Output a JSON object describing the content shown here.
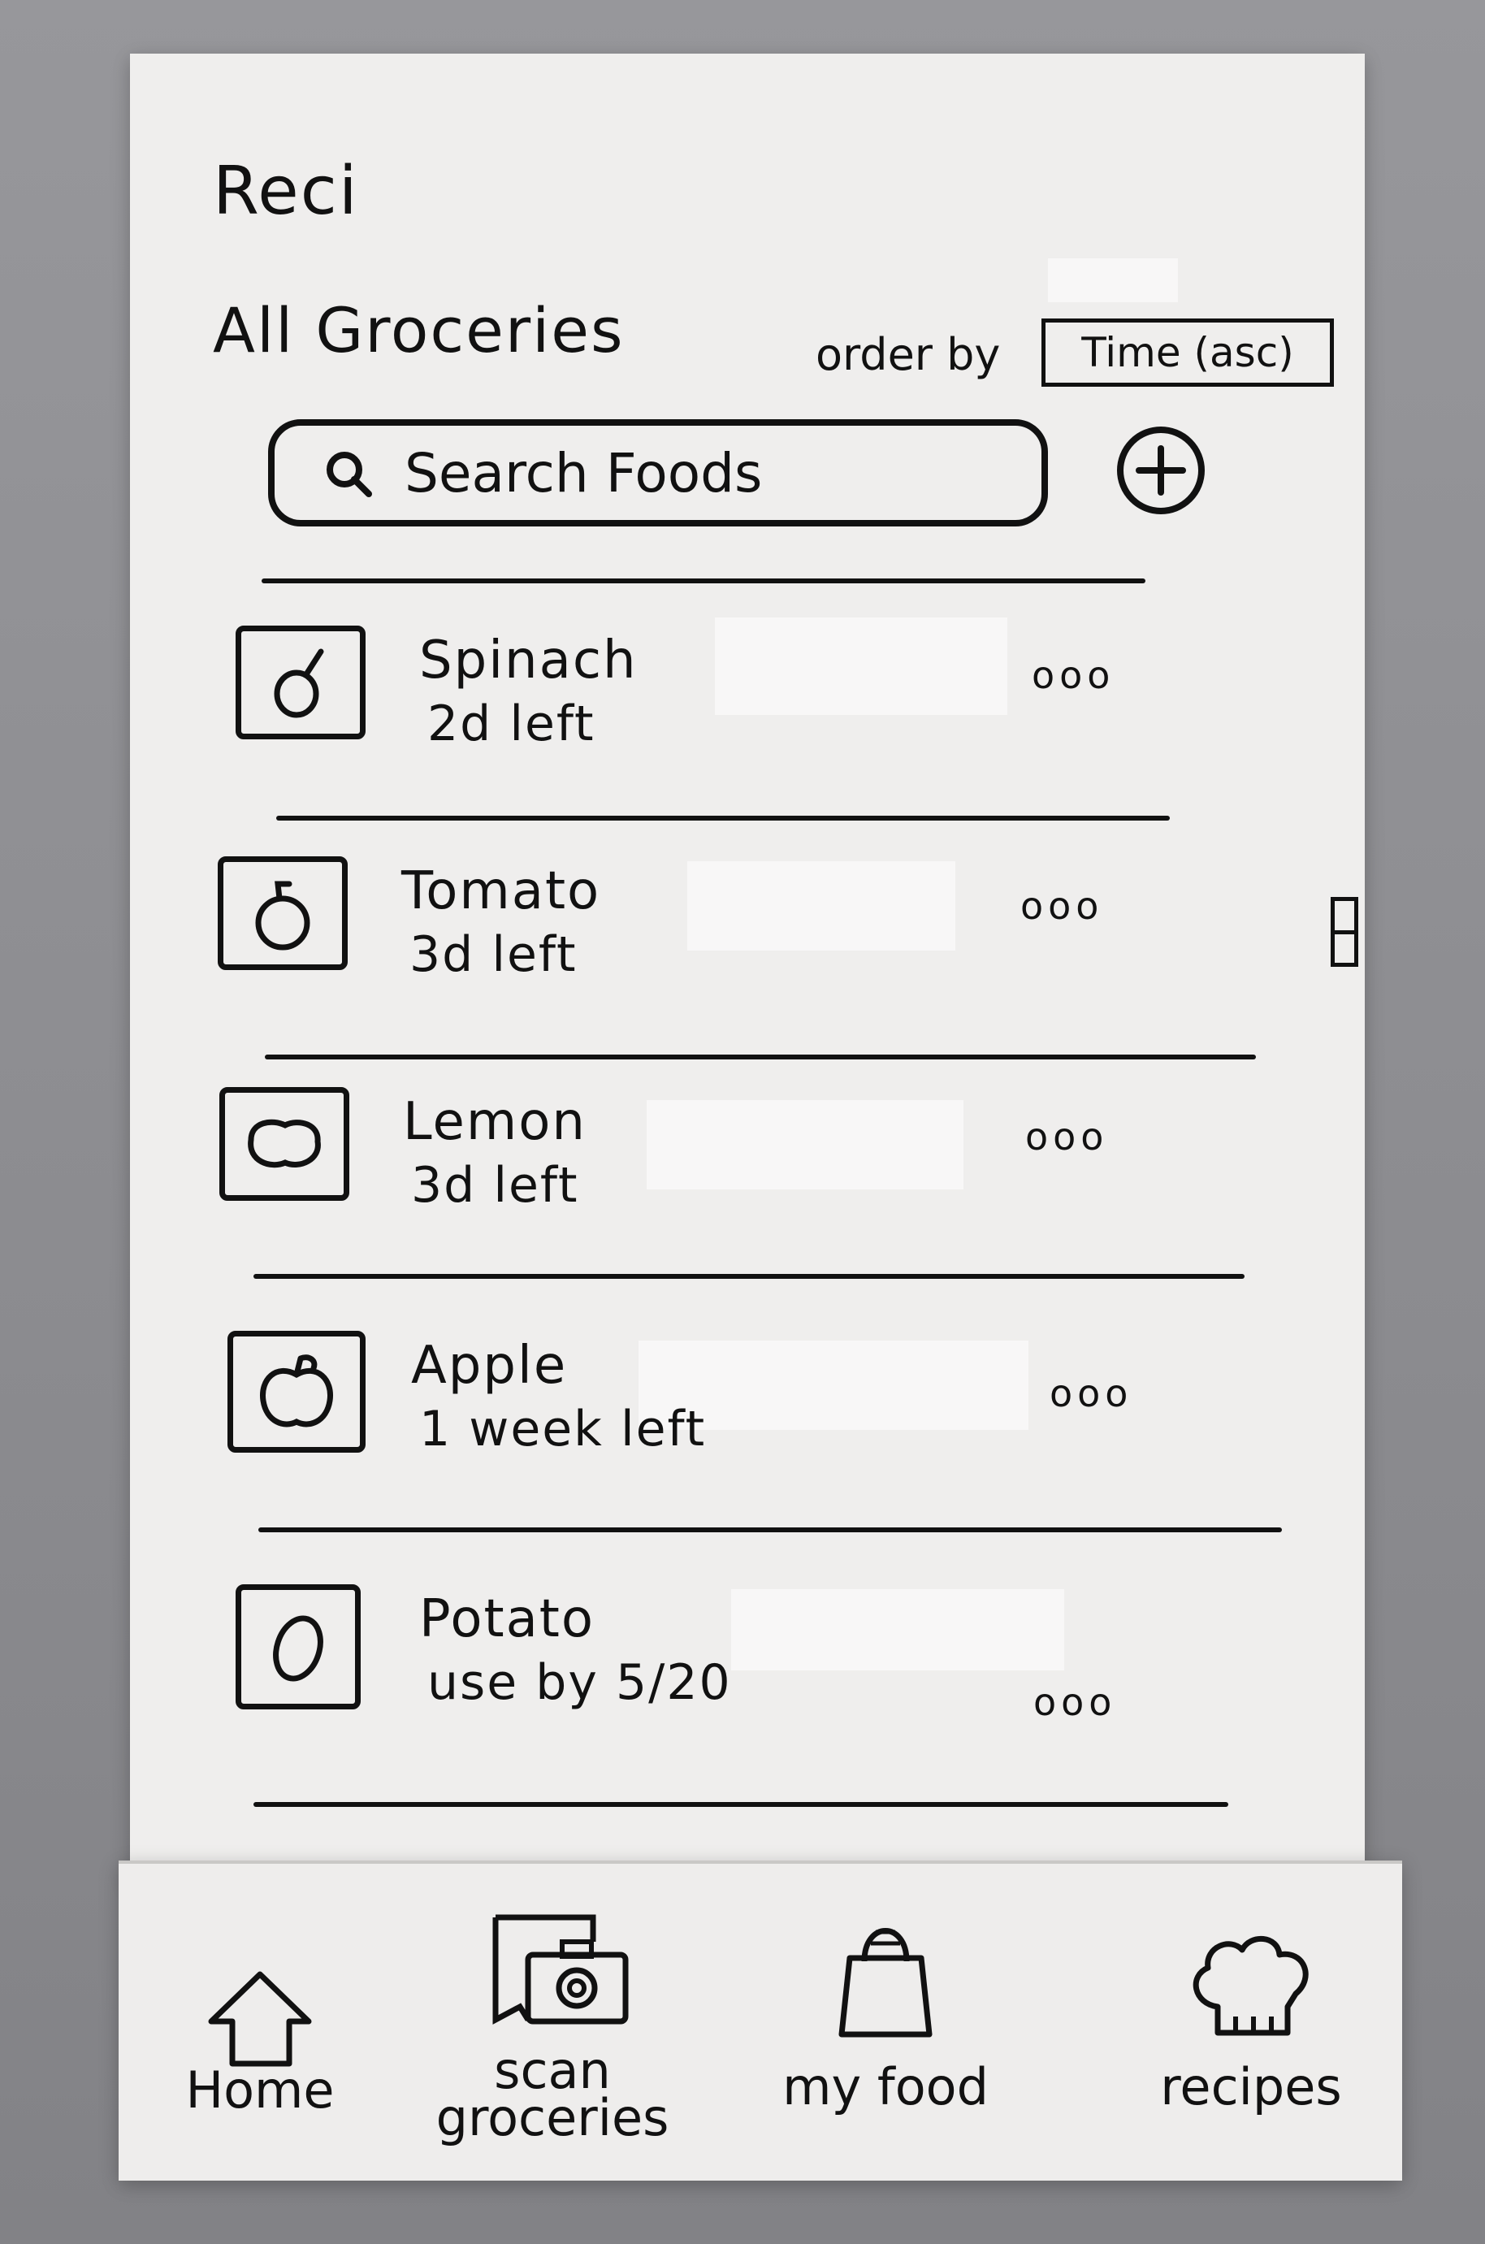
{
  "app": {
    "title": "Reci"
  },
  "header": {
    "section_title": "All Groceries",
    "order_label": "order by",
    "order_value": "Time (asc)"
  },
  "search": {
    "placeholder": "Search Foods"
  },
  "items": [
    {
      "name": "Spinach",
      "status": "2d left",
      "icon": "spinach-icon",
      "more": "ooo"
    },
    {
      "name": "Tomato",
      "status": "3d left",
      "icon": "tomato-icon",
      "more": "ooo"
    },
    {
      "name": "Lemon",
      "status": "3d left",
      "icon": "lemon-icon",
      "more": "ooo"
    },
    {
      "name": "Apple",
      "status": "1 week left",
      "icon": "apple-icon",
      "more": "ooo"
    },
    {
      "name": "Potato",
      "status": "use by 5/20",
      "icon": "potato-icon",
      "more": "ooo"
    }
  ],
  "nav": [
    {
      "label": "Home",
      "icon": "home-icon"
    },
    {
      "label": "scan groceries",
      "icon": "scan-camera-icon"
    },
    {
      "label": "my food",
      "icon": "shopping-bag-icon"
    },
    {
      "label": "recipes",
      "icon": "chef-hat-icon"
    }
  ],
  "colors": {
    "ink": "#111111",
    "paper": "#efeeed",
    "background": "#8f8f92"
  }
}
